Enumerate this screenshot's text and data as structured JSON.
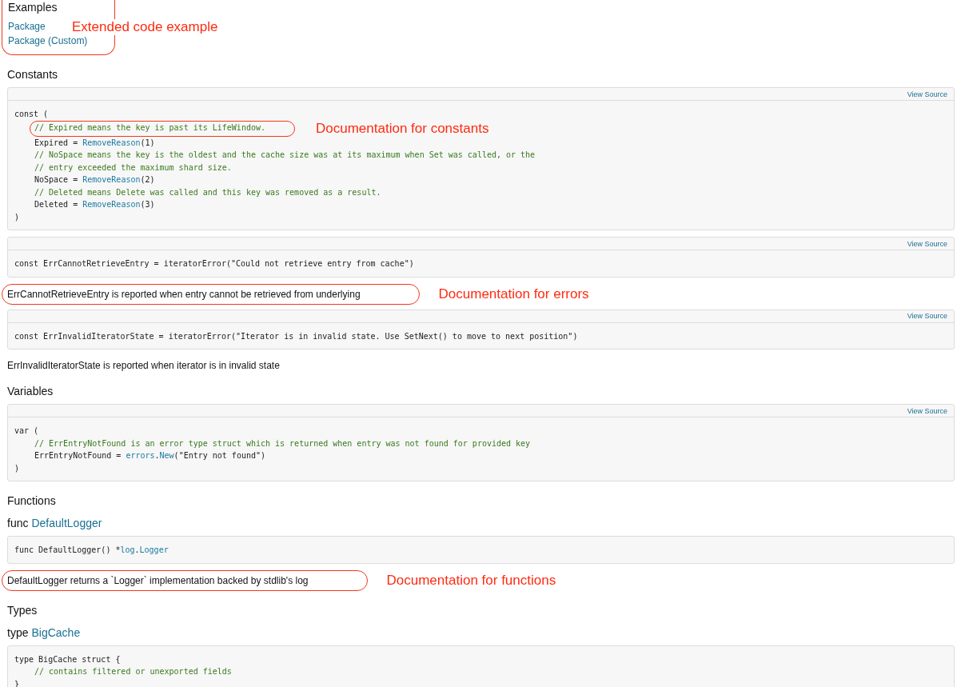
{
  "examples": {
    "heading": "Examples",
    "links": [
      "Package",
      "Package (Custom)"
    ],
    "annotation": "Extended code example"
  },
  "sections": [
    {
      "heading": "Constants",
      "items": [
        {
          "kind": "code",
          "view_source": "View Source",
          "lines": [
            {
              "indent": false,
              "tokens": [
                {
                  "kind": "plain",
                  "text": "const ("
                }
              ]
            },
            {
              "indent": true,
              "tokens": [
                {
                  "kind": "comment",
                  "text": "// Expired means the key is past its LifeWindow.",
                  "annotation": "Documentation for constants"
                }
              ]
            },
            {
              "indent": true,
              "tokens": [
                {
                  "kind": "plain",
                  "text": "Expired = "
                },
                {
                  "kind": "link",
                  "text": "RemoveReason"
                },
                {
                  "kind": "plain",
                  "text": "(1)"
                }
              ]
            },
            {
              "indent": true,
              "tokens": [
                {
                  "kind": "comment",
                  "text": "// NoSpace means the key is the oldest and the cache size was at its maximum when Set was called, or the"
                }
              ]
            },
            {
              "indent": true,
              "tokens": [
                {
                  "kind": "comment",
                  "text": "// entry exceeded the maximum shard size."
                }
              ]
            },
            {
              "indent": true,
              "tokens": [
                {
                  "kind": "plain",
                  "text": "NoSpace = "
                },
                {
                  "kind": "link",
                  "text": "RemoveReason"
                },
                {
                  "kind": "plain",
                  "text": "(2)"
                }
              ]
            },
            {
              "indent": true,
              "tokens": [
                {
                  "kind": "comment",
                  "text": "// Deleted means Delete was called and this key was removed as a result."
                }
              ]
            },
            {
              "indent": true,
              "tokens": [
                {
                  "kind": "plain",
                  "text": "Deleted = "
                },
                {
                  "kind": "link",
                  "text": "RemoveReason"
                },
                {
                  "kind": "plain",
                  "text": "(3)"
                }
              ]
            },
            {
              "indent": false,
              "tokens": [
                {
                  "kind": "plain",
                  "text": ")"
                }
              ]
            }
          ]
        },
        {
          "kind": "code",
          "view_source": "View Source",
          "lines": [
            {
              "indent": false,
              "tokens": [
                {
                  "kind": "plain",
                  "text": "const ErrCannotRetrieveEntry = iteratorError(\"Could not retrieve entry from cache\")"
                }
              ]
            }
          ]
        },
        {
          "kind": "doc",
          "text": "ErrCannotRetrieveEntry is reported when entry cannot be retrieved from underlying",
          "annotation": "Documentation for errors"
        },
        {
          "kind": "code",
          "view_source": "View Source",
          "lines": [
            {
              "indent": false,
              "tokens": [
                {
                  "kind": "plain",
                  "text": "const ErrInvalidIteratorState = iteratorError(\"Iterator is in invalid state. Use SetNext() to move to next position\")"
                }
              ]
            }
          ]
        },
        {
          "kind": "doc",
          "text": "ErrInvalidIteratorState is reported when iterator is in invalid state"
        }
      ]
    },
    {
      "heading": "Variables",
      "items": [
        {
          "kind": "code",
          "view_source": "View Source",
          "lines": [
            {
              "indent": false,
              "tokens": [
                {
                  "kind": "plain",
                  "text": "var ("
                }
              ]
            },
            {
              "indent": true,
              "tokens": [
                {
                  "kind": "comment",
                  "text": "// ErrEntryNotFound is an error type struct which is returned when entry was not found for provided key"
                }
              ]
            },
            {
              "indent": true,
              "tokens": [
                {
                  "kind": "plain",
                  "text": "ErrEntryNotFound = "
                },
                {
                  "kind": "link",
                  "text": "errors"
                },
                {
                  "kind": "plain",
                  "text": "."
                },
                {
                  "kind": "link",
                  "text": "New"
                },
                {
                  "kind": "plain",
                  "text": "(\"Entry not found\")"
                }
              ]
            },
            {
              "indent": false,
              "tokens": [
                {
                  "kind": "plain",
                  "text": ")"
                }
              ]
            }
          ]
        }
      ]
    },
    {
      "heading": "Functions",
      "items": [
        {
          "kind": "decl",
          "keyword": "func",
          "name": "DefaultLogger"
        },
        {
          "kind": "code",
          "lines": [
            {
              "indent": false,
              "tokens": [
                {
                  "kind": "plain",
                  "text": "func DefaultLogger() *"
                },
                {
                  "kind": "link",
                  "text": "log"
                },
                {
                  "kind": "plain",
                  "text": "."
                },
                {
                  "kind": "link",
                  "text": "Logger"
                }
              ]
            }
          ]
        },
        {
          "kind": "doc",
          "text": "DefaultLogger returns a `Logger` implementation backed by stdlib's log",
          "annotation": "Documentation for functions"
        }
      ]
    },
    {
      "heading": "Types",
      "items": [
        {
          "kind": "decl",
          "keyword": "type",
          "name": "BigCache"
        },
        {
          "kind": "code",
          "lines": [
            {
              "indent": false,
              "tokens": [
                {
                  "kind": "plain",
                  "text": "type BigCache struct {"
                }
              ]
            },
            {
              "indent": true,
              "tokens": [
                {
                  "kind": "comment",
                  "text": "// contains filtered or unexported fields"
                }
              ]
            },
            {
              "indent": false,
              "tokens": [
                {
                  "kind": "plain",
                  "text": "}"
                }
              ]
            }
          ]
        }
      ]
    }
  ]
}
